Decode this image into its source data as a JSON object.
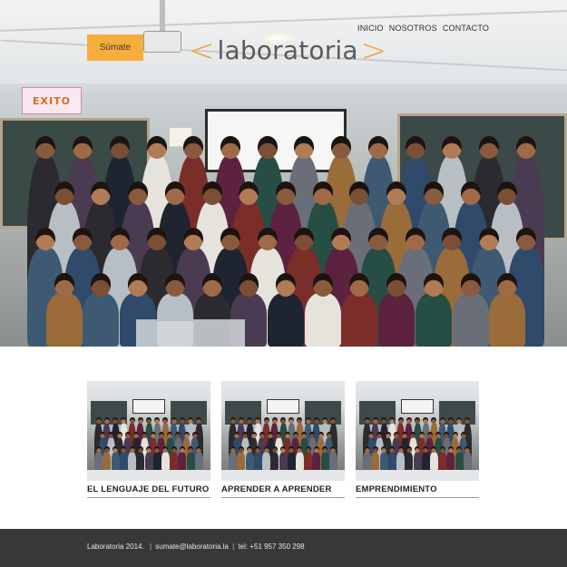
{
  "header": {
    "cta_label": "Súmate",
    "logo": {
      "left_bracket": "<",
      "word": "laboratoria",
      "right_bracket": ">"
    },
    "nav": [
      {
        "label": "INICIO"
      },
      {
        "label": "NOSOTROS"
      },
      {
        "label": "CONTACTO"
      }
    ]
  },
  "hero": {
    "poster_text": "EXITO"
  },
  "cards": [
    {
      "title": "EL LENGUAJE DEL FUTURO"
    },
    {
      "title": "APRENDER A APRENDER"
    },
    {
      "title": "EMPRENDIMIENTO"
    }
  ],
  "footer": {
    "copyright": "Laboratoria 2014.",
    "email": "sumate@laboratoria.la",
    "phone": "tel: +51 957 350 298",
    "separator": "|"
  },
  "colors": {
    "accent": "#f6ae3b",
    "logo_bracket": "#f0a22e",
    "footer_bg": "#383838"
  }
}
